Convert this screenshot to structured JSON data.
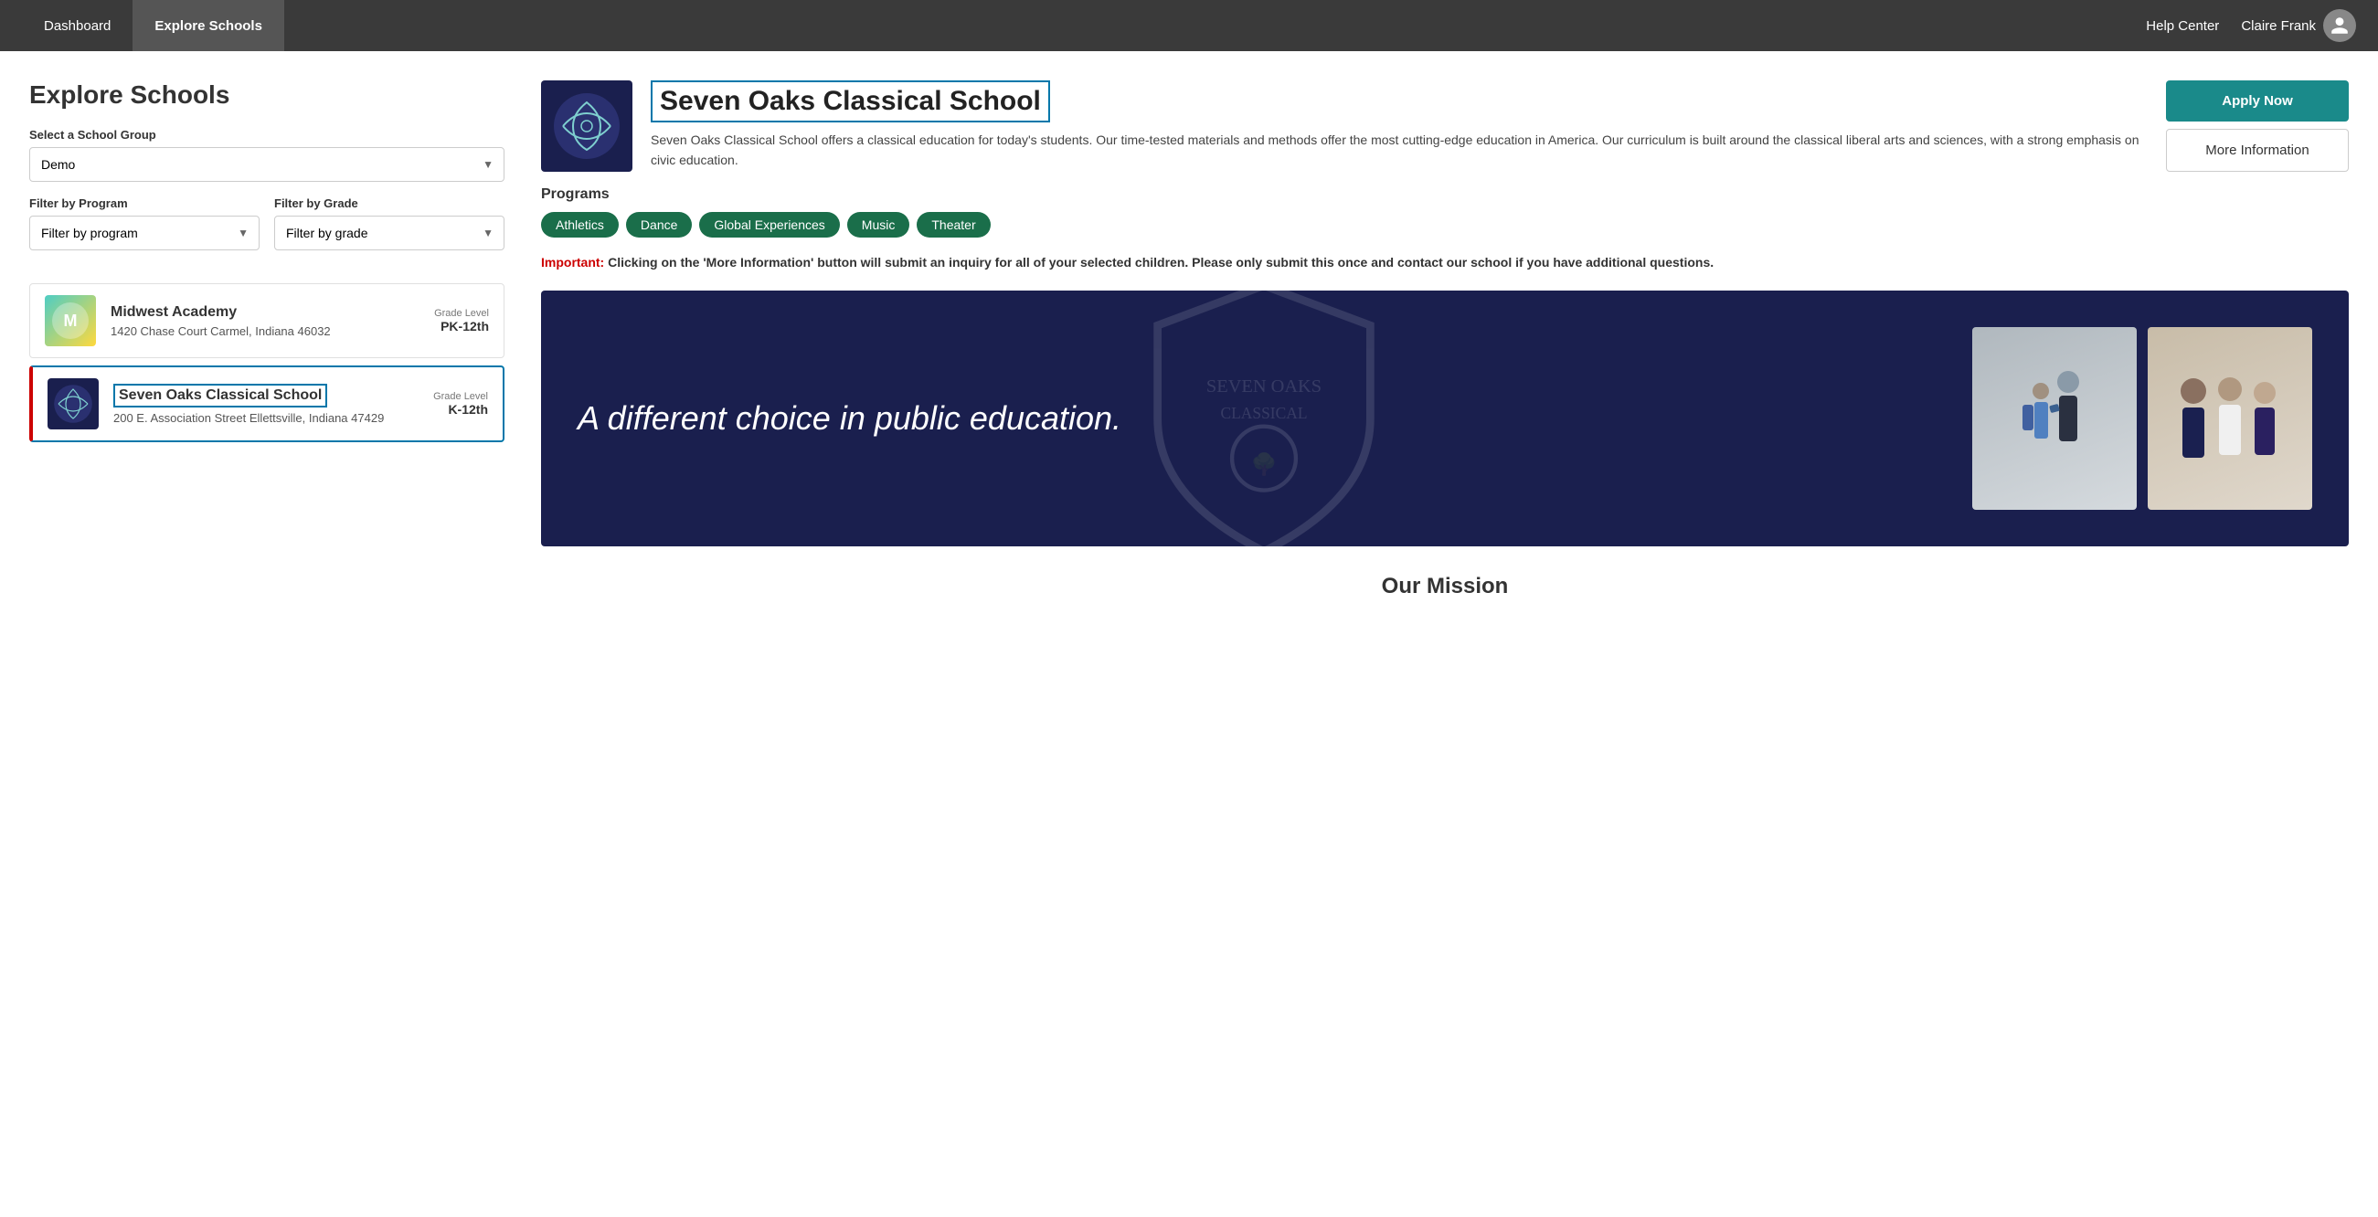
{
  "nav": {
    "dashboard_label": "Dashboard",
    "explore_label": "Explore Schools",
    "help_label": "Help Center",
    "user_name": "Claire Frank"
  },
  "page": {
    "title": "Explore Schools"
  },
  "left_panel": {
    "select_group_label": "Select a School Group",
    "select_group_value": "Demo",
    "filter_program_label": "Filter by Program",
    "filter_program_placeholder": "Filter by program",
    "filter_grade_label": "Filter by Grade",
    "filter_grade_placeholder": "Filter by grade"
  },
  "schools": [
    {
      "id": "midwest",
      "name": "Midwest Academy",
      "address": "1420 Chase Court Carmel, Indiana 46032",
      "grade_label": "Grade Level",
      "grade": "PK-12th",
      "selected": false
    },
    {
      "id": "sevenoaks",
      "name": "Seven Oaks Classical School",
      "address": "200 E. Association Street Ellettsville, Indiana 47429",
      "grade_label": "Grade Level",
      "grade": "K-12th",
      "selected": true
    }
  ],
  "detail": {
    "school_name": "Seven Oaks Classical School",
    "description": "Seven Oaks Classical School offers a classical education for today's students. Our time-tested materials and methods offer the most cutting-edge education in America. Our curriculum is built around the classical liberal arts and sciences, with a strong emphasis on civic education.",
    "apply_button": "Apply Now",
    "more_info_button": "More Information",
    "programs_title": "Programs",
    "programs": [
      "Athletics",
      "Dance",
      "Global Experiences",
      "Music",
      "Theater"
    ],
    "important_label": "Important:",
    "important_text": "Clicking on the 'More Information' button will submit an inquiry for all of your selected children. Please only submit this once and contact our school if you have additional questions.",
    "banner_text": "A different choice in public education.",
    "mission_heading": "Our Mission"
  }
}
